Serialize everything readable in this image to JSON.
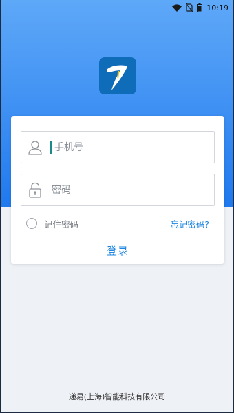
{
  "status_bar": {
    "time": "10:19",
    "icons": [
      "wifi-icon",
      "no-sim-icon",
      "battery-icon"
    ]
  },
  "app": {
    "logo_icon": "app-logo-icon",
    "brand_color": "#0f6cb8",
    "header_gradient": [
      "#5ea8f8",
      "#1f79ee"
    ]
  },
  "login_form": {
    "phone_placeholder": "手机号",
    "phone_icon": "user-icon",
    "password_placeholder": "密码",
    "password_icon": "unlock-icon",
    "remember_label": "记住密码",
    "remember_checked": false,
    "forgot_label": "忘记密码?",
    "login_label": "登录",
    "accent_color": "#1e86e0"
  },
  "footer": {
    "company": "递易(上海)智能科技有限公司"
  }
}
